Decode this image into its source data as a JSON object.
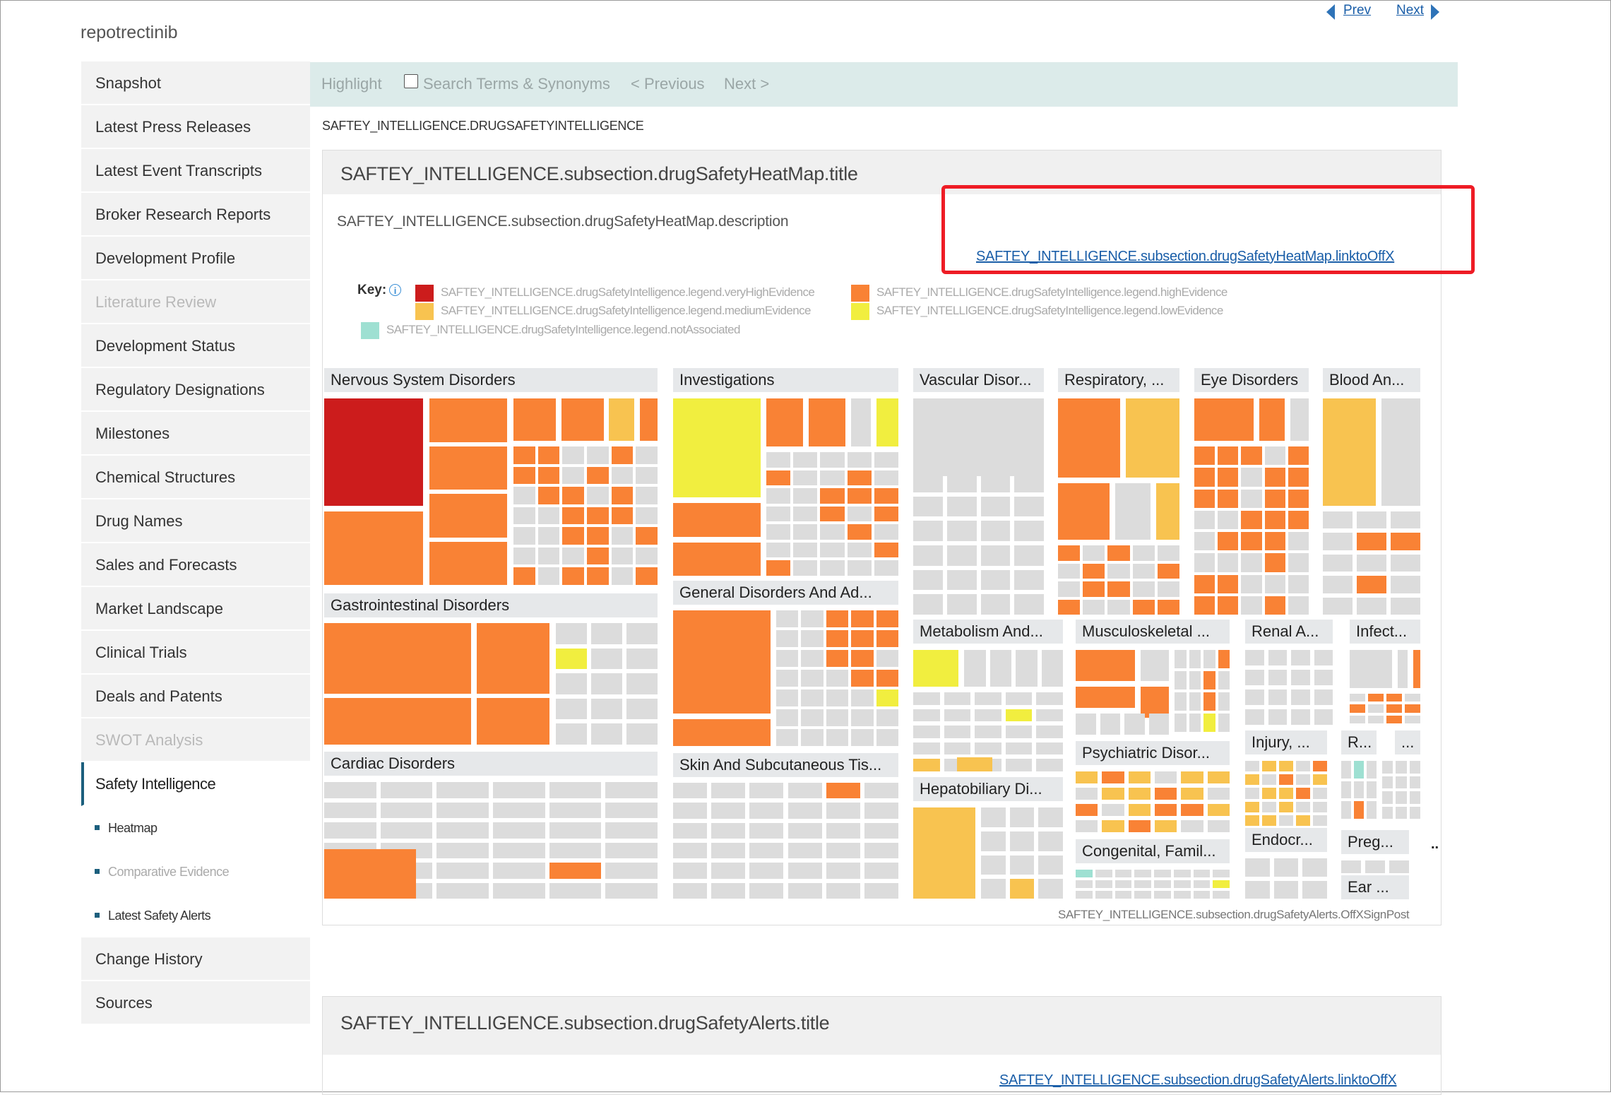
{
  "drug_title": "repotrectinib",
  "pager": {
    "prev": "Prev",
    "next": "Next"
  },
  "sidebar": {
    "items": [
      {
        "label": "Snapshot"
      },
      {
        "label": "Latest Press Releases"
      },
      {
        "label": "Latest Event Transcripts"
      },
      {
        "label": "Broker Research Reports"
      },
      {
        "label": "Development Profile"
      },
      {
        "label": "Literature Review",
        "disabled": true
      },
      {
        "label": "Development Status"
      },
      {
        "label": "Regulatory Designations"
      },
      {
        "label": "Milestones"
      },
      {
        "label": "Chemical Structures"
      },
      {
        "label": "Drug Names"
      },
      {
        "label": "Sales and Forecasts"
      },
      {
        "label": "Market Landscape"
      },
      {
        "label": "Clinical Trials"
      },
      {
        "label": "Deals and Patents"
      },
      {
        "label": "SWOT Analysis",
        "disabled": true
      },
      {
        "label": "Safety Intelligence",
        "active": true
      }
    ],
    "subitems": [
      {
        "label": "Heatmap"
      },
      {
        "label": "Comparative Evidence",
        "dim": true
      },
      {
        "label": "Latest Safety Alerts"
      }
    ],
    "bottom_items": [
      {
        "label": "Change History"
      },
      {
        "label": "Sources"
      }
    ]
  },
  "toolbar": {
    "highlight": "Highlight",
    "search_terms": "Search Terms & Synonyms",
    "previous": "< Previous",
    "next": "Next >"
  },
  "breadcrumb": "SAFTEY_INTELLIGENCE.DRUGSAFETYINTELLIGENCE",
  "heatmap": {
    "title": "SAFTEY_INTELLIGENCE.subsection.drugSafetyHeatMap.title",
    "description": "SAFTEY_INTELLIGENCE.subsection.drugSafetyHeatMap.description",
    "link": "SAFTEY_INTELLIGENCE.subsection.drugSafetyHeatMap.linktoOffX",
    "key_label": "Key:",
    "legend": [
      {
        "label": "SAFTEY_INTELLIGENCE.drugSafetyIntelligence.legend.veryHighEvidence",
        "color": "#cc1c1c"
      },
      {
        "label": "SAFTEY_INTELLIGENCE.drugSafetyIntelligence.legend.highEvidence",
        "color": "#f98235"
      },
      {
        "label": "SAFTEY_INTELLIGENCE.drugSafetyIntelligence.legend.mediumEvidence",
        "color": "#f8c350"
      },
      {
        "label": "SAFTEY_INTELLIGENCE.drugSafetyIntelligence.legend.lowEvidence",
        "color": "#f1ee3f"
      },
      {
        "label": "SAFTEY_INTELLIGENCE.drugSafetyIntelligence.legend.notAssociated",
        "color": "#9ee0d2"
      }
    ],
    "groups": [
      "Nervous System Disorders",
      "Investigations",
      "Vascular Disor...",
      "Respiratory, ...",
      "Eye Disorders",
      "Blood An...",
      "Gastrointestinal Disorders",
      "General Disorders And Ad...",
      "Metabolism And...",
      "Musculoskeletal ...",
      "Renal A...",
      "Infect...",
      "Cardiac Disorders",
      "Skin And Subcutaneous Tis...",
      "Hepatobiliary Di...",
      "Psychiatric Disor...",
      "Injury, ...",
      "R...",
      "...",
      "Congenital, Famil...",
      "Endocr...",
      "Preg...",
      "Ear ..."
    ],
    "more_marker": "..",
    "signpost": "SAFTEY_INTELLIGENCE.subsection.drugSafetyAlerts.OffXSignPost"
  },
  "alerts": {
    "title": "SAFTEY_INTELLIGENCE.subsection.drugSafetyAlerts.title",
    "link": "SAFTEY_INTELLIGENCE.subsection.drugSafetyAlerts.linktoOffX"
  },
  "colors": {
    "very_high": "#cc1c1c",
    "high": "#f98235",
    "medium": "#f8c350",
    "low": "#f1ee3f",
    "not_associated": "#9ee0d2",
    "none": "#dcdcdc"
  }
}
